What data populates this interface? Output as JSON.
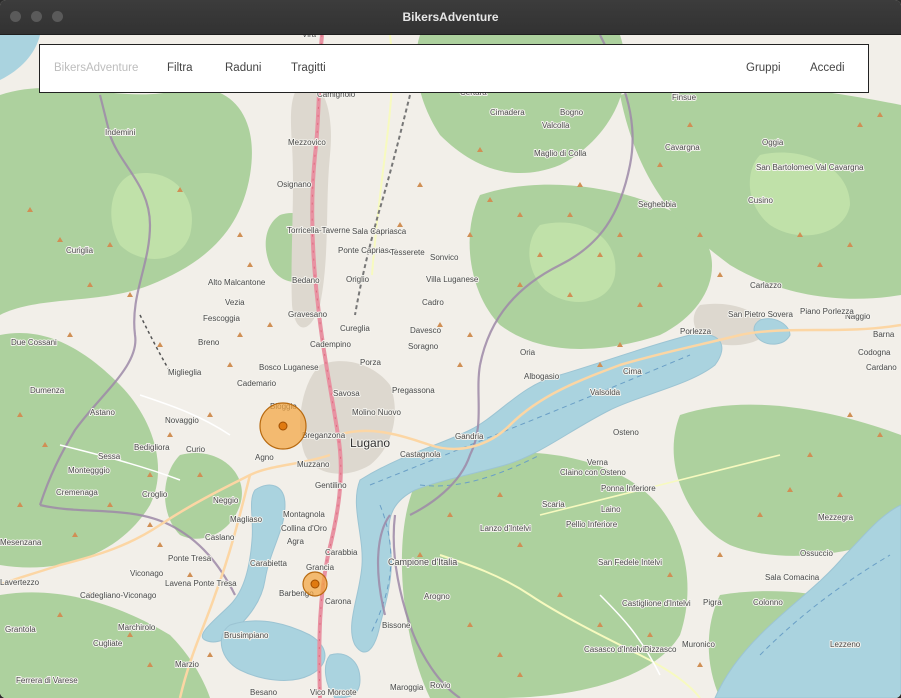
{
  "window": {
    "title": "BikersAdventure"
  },
  "navbar": {
    "brand": "BikersAdventure",
    "left_links": [
      "Filtra",
      "Raduni",
      "Tragitti"
    ],
    "right_links": [
      "Gruppi",
      "Accedi"
    ]
  },
  "map": {
    "center_label": "Lugano",
    "places": [
      {
        "name": "Lugano",
        "size": "big"
      },
      {
        "name": "Cima"
      },
      {
        "name": "Agra"
      },
      {
        "name": "Sessa"
      },
      {
        "name": "Croglio"
      },
      {
        "name": "Novaggio"
      },
      {
        "name": "Cademario"
      },
      {
        "name": "Bedigliora"
      },
      {
        "name": "Astano"
      },
      {
        "name": "Curio"
      },
      {
        "name": "Magliaso"
      },
      {
        "name": "Neggio"
      },
      {
        "name": "Caslano"
      },
      {
        "name": "Ponte Tresa"
      },
      {
        "name": "Lavena Ponte Tresa"
      },
      {
        "name": "Viconago"
      },
      {
        "name": "Cadegliano-Viconago"
      },
      {
        "name": "Marchirolo"
      },
      {
        "name": "Cugliate"
      },
      {
        "name": "Marzio"
      },
      {
        "name": "Besano"
      },
      {
        "name": "Brusimpiano"
      },
      {
        "name": "Carabietta"
      },
      {
        "name": "Barbengo"
      },
      {
        "name": "Grancia"
      },
      {
        "name": "Carona"
      },
      {
        "name": "Carabbia"
      },
      {
        "name": "Montagnola"
      },
      {
        "name": "Collina d'Oro"
      },
      {
        "name": "Gentilino"
      },
      {
        "name": "Muzzano"
      },
      {
        "name": "Breganzona"
      },
      {
        "name": "Bioggio"
      },
      {
        "name": "Agno"
      },
      {
        "name": "Savosa"
      },
      {
        "name": "Porza"
      },
      {
        "name": "Vezia"
      },
      {
        "name": "Cadempino"
      },
      {
        "name": "Cureglia"
      },
      {
        "name": "Origlio"
      },
      {
        "name": "Ponte Capriasca"
      },
      {
        "name": "Sala Capriasca"
      },
      {
        "name": "Tesserete"
      },
      {
        "name": "Sonvico"
      },
      {
        "name": "Villa Luganese"
      },
      {
        "name": "Cadro"
      },
      {
        "name": "Davesco"
      },
      {
        "name": "Soragno"
      },
      {
        "name": "Pregassona"
      },
      {
        "name": "Molino Nuovo"
      },
      {
        "name": "Castagnola"
      },
      {
        "name": "Gandria"
      },
      {
        "name": "Albogasio"
      },
      {
        "name": "Oria"
      },
      {
        "name": "Cima"
      },
      {
        "name": "Porlezza"
      },
      {
        "name": "Osteno"
      },
      {
        "name": "Claino con Osteno"
      },
      {
        "name": "Valsolda"
      },
      {
        "name": "Campione d'Italia",
        "size": "mid"
      },
      {
        "name": "Bissone"
      },
      {
        "name": "Maroggia"
      },
      {
        "name": "Rovio"
      },
      {
        "name": "Arogno"
      },
      {
        "name": "Vico Morcote"
      },
      {
        "name": "Lanzo d'Intelvi"
      },
      {
        "name": "Scaria"
      },
      {
        "name": "Pellio Inferiore"
      },
      {
        "name": "Laino"
      },
      {
        "name": "Ponna Inferiore"
      },
      {
        "name": "Verna"
      },
      {
        "name": "San Fedele Intelvi"
      },
      {
        "name": "Castiglione d'Intelvi"
      },
      {
        "name": "Casasco d'Intelvi"
      },
      {
        "name": "Dizzasco"
      },
      {
        "name": "Muronico"
      },
      {
        "name": "Pigra"
      },
      {
        "name": "Colonno"
      },
      {
        "name": "Sala Comacina"
      },
      {
        "name": "Ossuccio"
      },
      {
        "name": "Mezzegra"
      },
      {
        "name": "Lezzeno"
      },
      {
        "name": "Naggio"
      },
      {
        "name": "Barna"
      },
      {
        "name": "Codogna"
      },
      {
        "name": "Cardano"
      },
      {
        "name": "Piano Porlezza"
      },
      {
        "name": "San Pietro Sovera"
      },
      {
        "name": "Cusino"
      },
      {
        "name": "Carlazzo"
      },
      {
        "name": "San Bartolomeo Val Cavargna"
      },
      {
        "name": "Cavargna"
      },
      {
        "name": "Seghebbia"
      },
      {
        "name": "Oggia"
      },
      {
        "name": "Valcolla"
      },
      {
        "name": "Maglio di Colla"
      },
      {
        "name": "Bogno"
      },
      {
        "name": "Certara"
      },
      {
        "name": "Cimadera"
      },
      {
        "name": "Camignolo"
      },
      {
        "name": "Mezzovico"
      },
      {
        "name": "Osignano"
      },
      {
        "name": "Torricella-Taverne"
      },
      {
        "name": "Bedano"
      },
      {
        "name": "Gravesano"
      },
      {
        "name": "Alto Malcantone"
      },
      {
        "name": "Fescoggia"
      },
      {
        "name": "Breno"
      },
      {
        "name": "Miglieglia"
      },
      {
        "name": "Indemini"
      },
      {
        "name": "Curiglia"
      },
      {
        "name": "Due Cossani"
      },
      {
        "name": "Dumenza"
      },
      {
        "name": "Montegggio"
      },
      {
        "name": "Cremenaga"
      },
      {
        "name": "Lavertezzo"
      },
      {
        "name": "Grantola"
      },
      {
        "name": "Ferrera di Varese"
      },
      {
        "name": "Mesenzana"
      },
      {
        "name": "Bosco Luganese"
      },
      {
        "name": "Vira"
      },
      {
        "name": "Rivera"
      },
      {
        "name": "Finsue"
      }
    ],
    "markers": [
      {
        "label": "cluster-large"
      },
      {
        "label": "cluster-small"
      }
    ]
  },
  "colors": {
    "accent": "#f0a020",
    "marker_fill": "#f2a541",
    "marker_stroke": "#c46a00",
    "lake": "#aad3df",
    "forest": "#add19e",
    "land": "#f2efe9"
  }
}
